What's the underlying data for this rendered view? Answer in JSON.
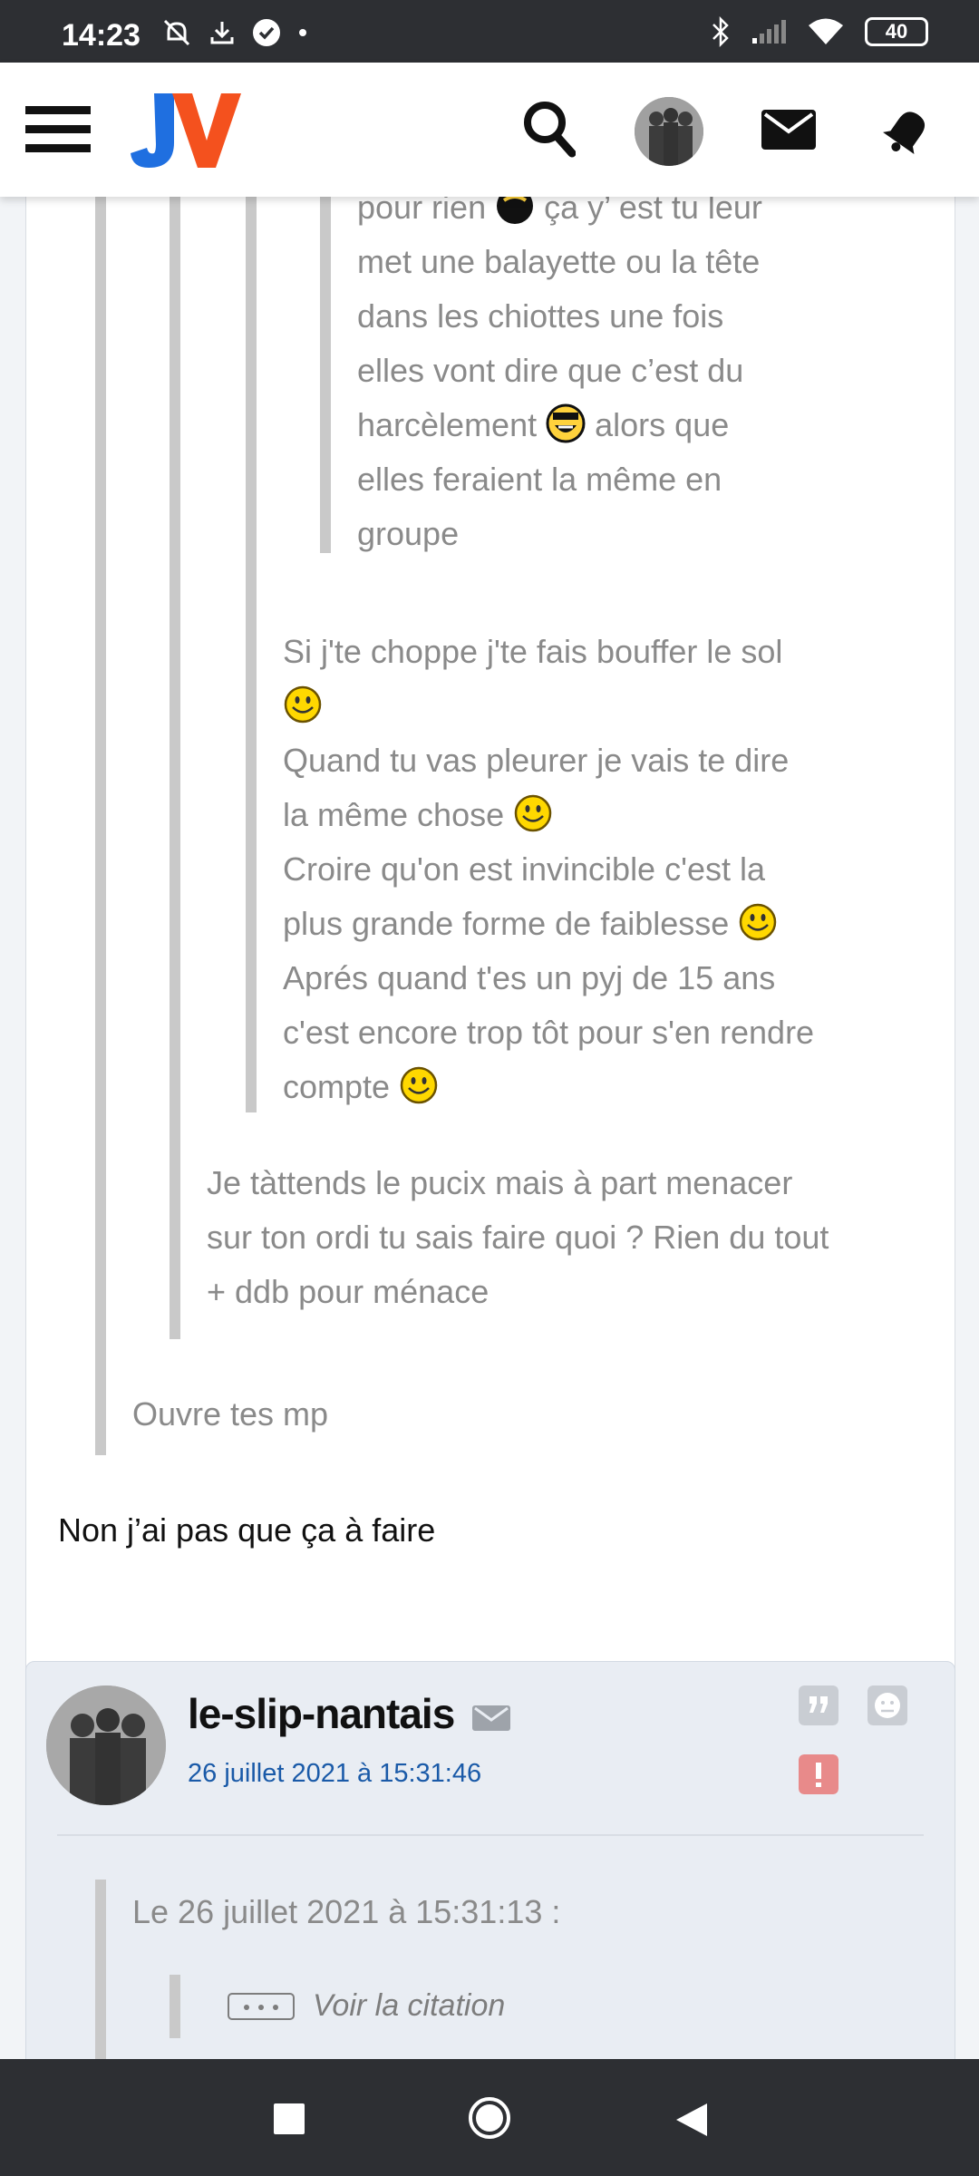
{
  "status_bar": {
    "time": "14:23",
    "icons_left": [
      "notifications-off-icon",
      "download-icon",
      "check-circle-icon",
      "dot-icon"
    ],
    "icons_right": [
      "bluetooth-icon",
      "signal-icon",
      "wifi-icon"
    ],
    "battery": "40"
  },
  "header": {
    "logo": "JV",
    "icons": [
      "menu-icon",
      "search-icon",
      "avatar",
      "mail-icon",
      "notification-icon"
    ]
  },
  "thread": {
    "quote_level4": {
      "lines": [
        "pour rien",
        "ça y’ est tu leur",
        "met une balayette ou la tête",
        "dans les chiottes une fois",
        "elles vont dire que c’est du",
        "harcèlement",
        "alors que",
        "elles feraient la même en",
        "groupe"
      ]
    },
    "quote_level3": {
      "lines": [
        "Si j'te choppe j'te fais bouffer le sol",
        "Quand tu vas pleurer je vais te dire",
        "la même chose",
        "Croire qu'on est invincible c'est la",
        "plus grande forme de faiblesse",
        "Aprés quand t'es un pyj de 15 ans",
        "c'est encore trop tôt pour s'en rendre",
        "compte"
      ]
    },
    "quote_level2": {
      "lines": [
        "Je tàttends le pucix mais à part menacer",
        "sur ton ordi tu sais faire quoi ? Rien du tout",
        "+ ddb pour ménace"
      ]
    },
    "quote_level1": "Ouvre tes mp",
    "reply": "Non j’ai pas que ça à faire"
  },
  "post2": {
    "author": "le-slip-nantais",
    "date": "26 juillet 2021 à 15:31:46",
    "quote_header": "Le 26 juillet 2021 à 15:31:13 :",
    "voir_citation": "Voir la citation"
  },
  "colors": {
    "status_bar": "#2d2f33",
    "logo_blue": "#1f6fe0",
    "logo_orange": "#f4511e",
    "quote_text": "#8a8a8a",
    "date_link": "#1a5aa8",
    "alert_red": "#e88a8a"
  }
}
